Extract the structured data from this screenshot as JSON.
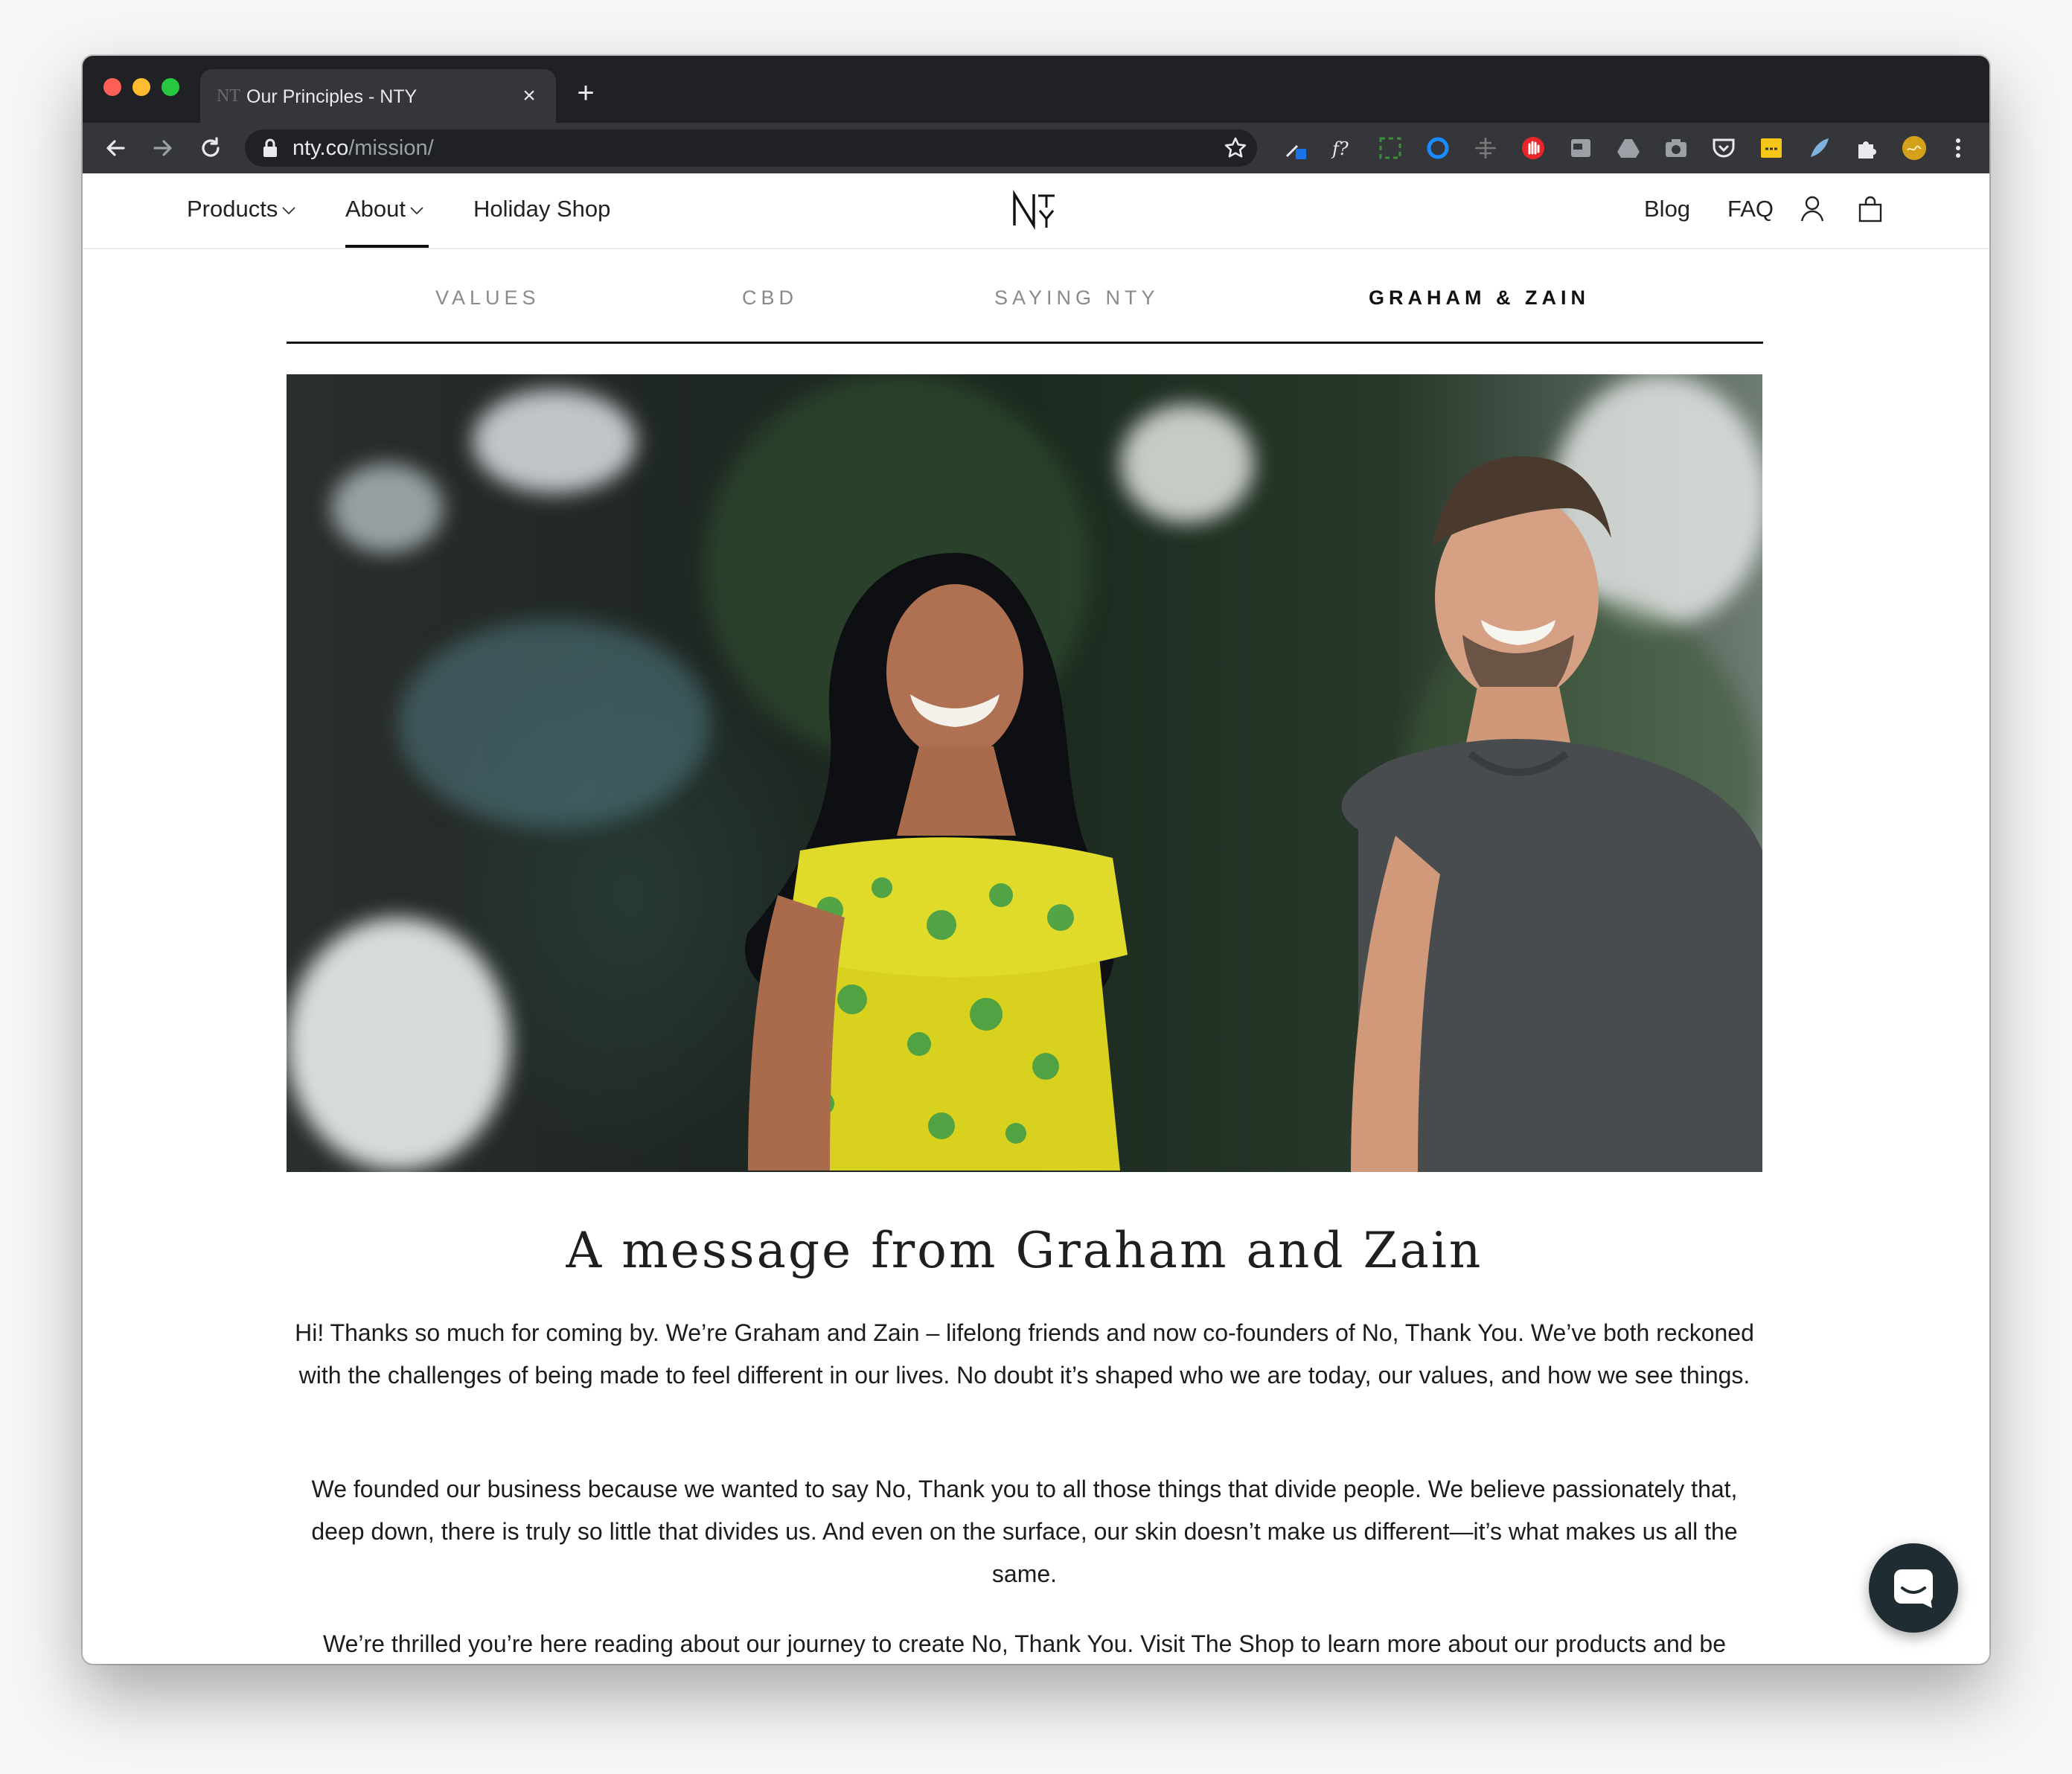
{
  "browser": {
    "tab_title": "Our Principles - NTY",
    "tab_favicon": "NT",
    "url_host": "nty.co",
    "url_path": "/mission/",
    "new_tab_label": "+",
    "close_label": "×"
  },
  "site_nav": {
    "left": [
      {
        "label": "Products",
        "has_dropdown": true
      },
      {
        "label": "About",
        "has_dropdown": true,
        "active": true
      },
      {
        "label": "Holiday Shop",
        "has_dropdown": false
      }
    ],
    "logo_text": "NTY",
    "right": [
      {
        "label": "Blog"
      },
      {
        "label": "FAQ"
      }
    ]
  },
  "subnav": [
    {
      "label": "VALUES",
      "active": false
    },
    {
      "label": "CBD",
      "active": false
    },
    {
      "label": "SAYING NTY",
      "active": false
    },
    {
      "label": "GRAHAM & ZAIN",
      "active": true
    }
  ],
  "content": {
    "headline": "A message from Graham and Zain",
    "paragraphs": [
      "Hi! Thanks so much for coming by. We’re Graham and Zain – lifelong friends and now co-founders of No, Thank You. We’ve both reckoned with the challenges of being made to feel different in our lives. No doubt it’s shaped who we are today, our values, and how we see things.",
      "We founded our business because we wanted to say No, Thank you to all those things that divide people. We believe passionately that, deep down, there is truly so little that divides us. And even on the surface, our skin doesn’t make us different—it’s what makes us all the same.",
      "We’re thrilled you’re here reading about our journey to create No, Thank You. Visit The Shop to learn more about our products and be"
    ]
  },
  "colors": {
    "chrome_dark": "#202124",
    "chrome_toolbar": "#35363a",
    "text_primary": "#1c1c1c",
    "subnav_inactive": "#8a8a8a",
    "chat_button": "#1f2d33"
  }
}
